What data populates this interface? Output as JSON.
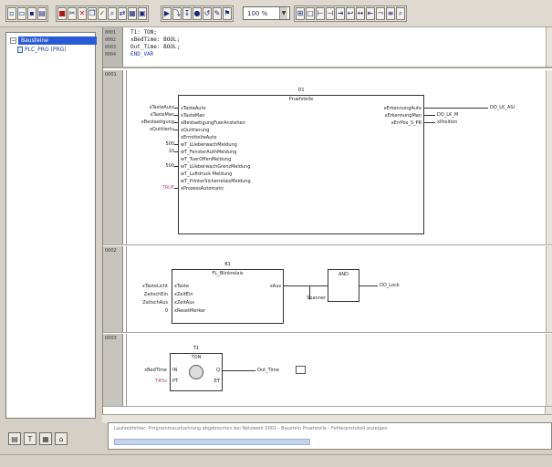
{
  "toolbar": {
    "zoom_value": "100 %"
  },
  "tree": {
    "root_label": "Bausteine",
    "child_label": "PLC_PRG (PRG)"
  },
  "declaration": {
    "line_numbers": [
      "0001",
      "0002",
      "0003",
      "0004"
    ],
    "lines": [
      "T1: TON;",
      "xBedTime: BOOL;",
      "Out_Time: BOOL;",
      "END_VAR"
    ]
  },
  "networks": [
    {
      "number": "0001",
      "block": {
        "instance": "D1",
        "type": "Pruefstelle",
        "inputs": [
          "xTasteAuto",
          "xTasteMan",
          "xBestaetigungFuerAnstehen",
          "xQuittierung",
          "xErmittelteAuto",
          "wT_LUeberwachMeldung",
          "wT_FensterAuthMeldung",
          "wT_TuerOffenMeldung",
          "wT_LUeberwachGrenzMeldung",
          "wT_Luftdruck Meldung",
          "wT_PrinterSicherrelaisMeldung",
          "xProzessAutomatic"
        ],
        "outputs": [
          "xErkennungAuto",
          "xErkennungMan",
          "xErrPos_S_PR"
        ]
      },
      "left_vars": [
        "xTasteAuto",
        "xTasteMan",
        "xBestaetigung",
        "xQuittiertu",
        "",
        "500",
        "10",
        "",
        "500",
        "",
        "",
        "TRUE"
      ],
      "right_vars": [
        "DO_LK_ASI",
        "DO_LK_M",
        "xPosition"
      ]
    },
    {
      "number": "0002",
      "block": {
        "instance": "B1",
        "type": "FL_Blinkrelais",
        "inputs": [
          "xTaste",
          "xZeitEin",
          "xZeitAus",
          "xResetMerker"
        ],
        "outputs": [
          "xAus"
        ]
      },
      "left_vars": [
        "xTasteLicht",
        "ZeitschEin",
        "ZeitschAus",
        "0"
      ],
      "mid_label": "Spanner",
      "and_block": "AND",
      "right_var": "DO_Lock"
    },
    {
      "number": "0003",
      "block": {
        "instance": "T1",
        "type": "TON",
        "inputs": [
          "IN",
          "PT"
        ],
        "outputs": [
          "Q",
          "ET"
        ]
      },
      "left_vars": [
        "xBedTime",
        "T#5s"
      ],
      "right_var": "Out_Time"
    }
  ],
  "messages": {
    "text": "Laufzeitfehler: Programmausfuehrung abgebrochen bei Netzwerk 0001 - Baustein Pruefstelle - Fehlerprotokoll anzeigen"
  }
}
